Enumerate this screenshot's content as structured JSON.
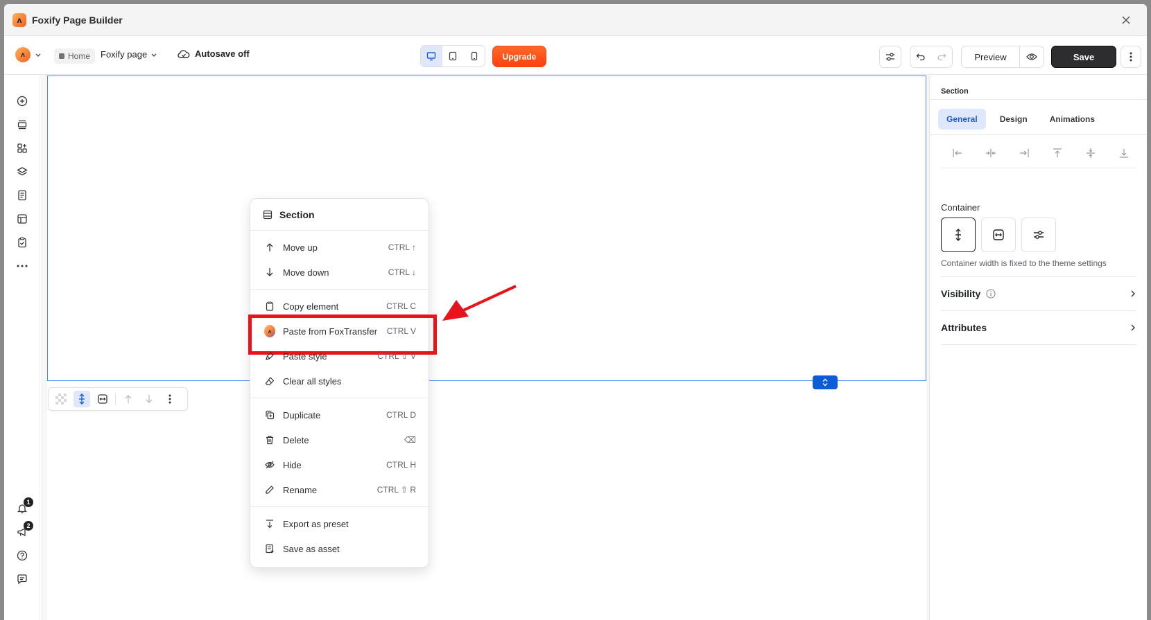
{
  "window": {
    "title": "Foxify Page Builder"
  },
  "toolbar": {
    "home_label": "Home",
    "page_name": "Foxify page",
    "autosave": "Autosave off",
    "upgrade": "Upgrade",
    "preview": "Preview",
    "save": "Save"
  },
  "left_sidebar": {
    "notifications_badge": "1",
    "announcements_badge": "2"
  },
  "context_menu": {
    "title": "Section",
    "groups": [
      [
        {
          "label": "Move up",
          "shortcut": "CTRL ↑",
          "icon": "arrow-up-icon"
        },
        {
          "label": "Move down",
          "shortcut": "CTRL ↓",
          "icon": "arrow-down-icon"
        }
      ],
      [
        {
          "label": "Copy element",
          "shortcut": "CTRL C",
          "icon": "clipboard-icon"
        },
        {
          "label": "Paste from FoxTransfer",
          "shortcut": "CTRL V",
          "icon": "foxtransfer-icon"
        },
        {
          "label": "Paste style",
          "shortcut": "CTRL ⇧ V",
          "icon": "brush-icon"
        },
        {
          "label": "Clear all styles",
          "shortcut": "",
          "icon": "eraser-icon"
        }
      ],
      [
        {
          "label": "Duplicate",
          "shortcut": "CTRL D",
          "icon": "duplicate-icon"
        },
        {
          "label": "Delete",
          "shortcut": "⌫",
          "icon": "trash-icon"
        },
        {
          "label": "Hide",
          "shortcut": "CTRL H",
          "icon": "eye-off-icon"
        },
        {
          "label": "Rename",
          "shortcut": "CTRL ⇧ R",
          "icon": "pencil-icon"
        }
      ],
      [
        {
          "label": "Export as preset",
          "shortcut": "",
          "icon": "export-icon"
        },
        {
          "label": "Save as asset",
          "shortcut": "",
          "icon": "save-asset-icon"
        }
      ]
    ],
    "highlight_color": "#e8131b"
  },
  "right_panel": {
    "title": "Section",
    "tabs": [
      "General",
      "Design",
      "Animations"
    ],
    "active_tab": "General",
    "container_label": "Container",
    "container_help": "Container width is fixed to the theme settings",
    "visibility": "Visibility",
    "attributes": "Attributes"
  },
  "colors": {
    "accent": "#1c5fd4",
    "upgrade": "#ff4f14",
    "save_bg": "#2d2d2f",
    "selection": "#4a8df0"
  }
}
